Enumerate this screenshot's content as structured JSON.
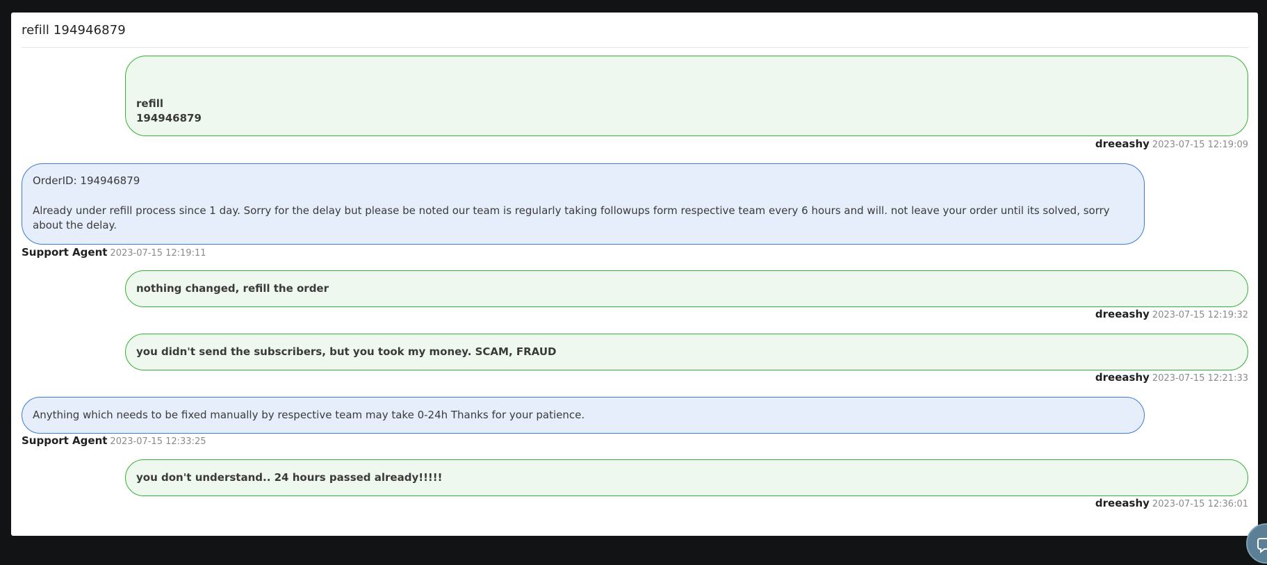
{
  "ticket": {
    "title": "refill 194946879"
  },
  "messages": [
    {
      "role": "user",
      "lines": [
        "refill",
        "194946879"
      ],
      "author": "dreeashy",
      "time": "2023-07-15 12:19:09"
    },
    {
      "role": "agent",
      "lines": [
        "OrderID: 194946879",
        "Already under refill process since 1 day. Sorry for the delay but please be noted our team is regularly taking followups form respective team every 6 hours and will. not leave your order until its solved, sorry about the delay."
      ],
      "author": "Support Agent",
      "time": "2023-07-15 12:19:11"
    },
    {
      "role": "user",
      "lines": [
        "nothing changed, refill the order"
      ],
      "author": "dreeashy",
      "time": "2023-07-15 12:19:32"
    },
    {
      "role": "user",
      "lines": [
        "you didn't send the subscribers, but you took my money. SCAM, FRAUD"
      ],
      "author": "dreeashy",
      "time": "2023-07-15 12:21:33"
    },
    {
      "role": "agent",
      "lines": [
        "Anything which needs to be fixed manually by respective team may take 0-24h Thanks for your patience."
      ],
      "author": "Support Agent",
      "time": "2023-07-15 12:33:25"
    },
    {
      "role": "user",
      "lines": [
        "you don't understand.. 24 hours passed already!!!!!"
      ],
      "author": "dreeashy",
      "time": "2023-07-15 12:36:01"
    }
  ],
  "colors": {
    "user_bubble_bg": "#eef8ee",
    "user_bubble_border": "#35b235",
    "agent_bubble_bg": "#e6eefb",
    "agent_bubble_border": "#3d7ad8",
    "page_bg": "#121314"
  },
  "icons": {
    "chat_widget": "chat-bubble-icon"
  }
}
